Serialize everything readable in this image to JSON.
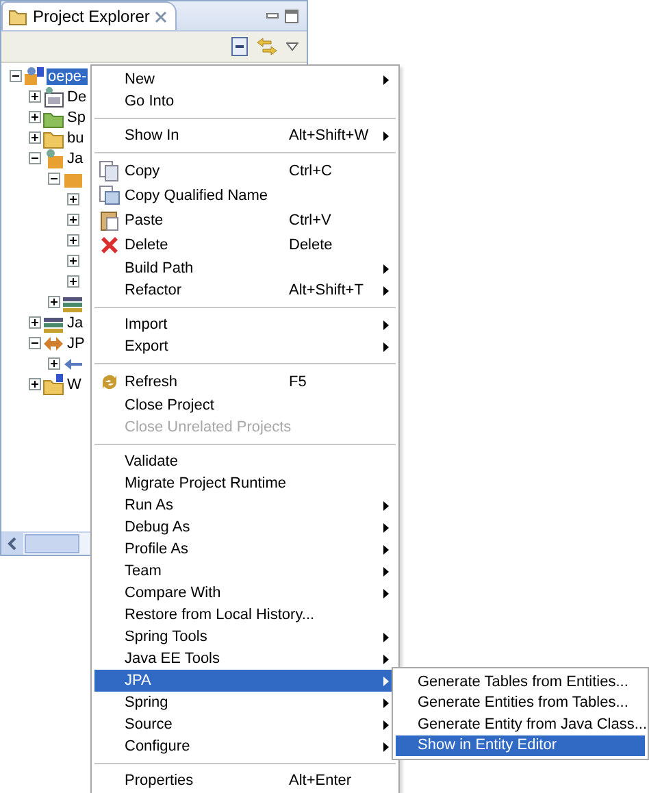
{
  "panel": {
    "title": "Project Explorer"
  },
  "tree": [
    {
      "label": "oepe-",
      "kind": "project",
      "expanded": true,
      "selected": true,
      "children": [
        {
          "label": "De",
          "kind": "descriptor",
          "expanded": false,
          "selected": false
        },
        {
          "label": "Sp",
          "kind": "spring",
          "expanded": false,
          "selected": false
        },
        {
          "label": "bu",
          "kind": "folder",
          "expanded": false,
          "selected": false
        },
        {
          "label": "Ja",
          "kind": "java-resources",
          "expanded": true,
          "selected": false,
          "children": [
            {
              "kind": "source",
              "expanded": true,
              "children": [
                {
                  "expanded": false
                },
                {
                  "expanded": false
                },
                {
                  "expanded": false
                },
                {
                  "expanded": false
                },
                {
                  "expanded": false
                }
              ]
            },
            {
              "kind": "library",
              "expanded": false
            }
          ]
        },
        {
          "label": "Ja",
          "kind": "library",
          "expanded": false,
          "selected": false
        },
        {
          "label": "JP",
          "kind": "jpa",
          "expanded": true,
          "selected": false,
          "children": [
            {
              "kind": "jpa-small",
              "expanded": false
            }
          ]
        },
        {
          "label": "W",
          "kind": "web",
          "expanded": false,
          "selected": false
        }
      ]
    }
  ],
  "context_menu": [
    {
      "kind": "plain",
      "label": "New",
      "submenu": true,
      "disabled": false,
      "selected": false
    },
    {
      "kind": "plain",
      "label": "Go Into",
      "submenu": false,
      "disabled": false,
      "selected": false
    },
    {
      "kind": "separator"
    },
    {
      "kind": "plain",
      "label": "Show In",
      "shortcut": "Alt+Shift+W",
      "submenu": true,
      "disabled": false,
      "selected": false
    },
    {
      "kind": "separator"
    },
    {
      "kind": "copy",
      "label": "Copy",
      "shortcut": "Ctrl+C",
      "submenu": false,
      "disabled": false,
      "selected": false
    },
    {
      "kind": "copy-qualified",
      "label": "Copy Qualified Name",
      "submenu": false,
      "disabled": false,
      "selected": false
    },
    {
      "kind": "paste",
      "label": "Paste",
      "shortcut": "Ctrl+V",
      "submenu": false,
      "disabled": false,
      "selected": false
    },
    {
      "kind": "delete",
      "label": "Delete",
      "shortcut": "Delete",
      "submenu": false,
      "disabled": false,
      "selected": false
    },
    {
      "kind": "plain",
      "label": "Build Path",
      "submenu": true,
      "disabled": false,
      "selected": false
    },
    {
      "kind": "plain",
      "label": "Refactor",
      "shortcut": "Alt+Shift+T",
      "submenu": true,
      "disabled": false,
      "selected": false
    },
    {
      "kind": "separator"
    },
    {
      "kind": "plain",
      "label": "Import",
      "submenu": true,
      "disabled": false,
      "selected": false
    },
    {
      "kind": "plain",
      "label": "Export",
      "submenu": true,
      "disabled": false,
      "selected": false
    },
    {
      "kind": "separator"
    },
    {
      "kind": "refresh",
      "label": "Refresh",
      "shortcut": "F5",
      "submenu": false,
      "disabled": false,
      "selected": false
    },
    {
      "kind": "plain",
      "label": "Close Project",
      "submenu": false,
      "disabled": false,
      "selected": false
    },
    {
      "kind": "plain",
      "label": "Close Unrelated Projects",
      "submenu": false,
      "disabled": true,
      "selected": false
    },
    {
      "kind": "separator"
    },
    {
      "kind": "plain",
      "label": "Validate",
      "submenu": false,
      "disabled": false,
      "selected": false
    },
    {
      "kind": "plain",
      "label": "Migrate Project Runtime",
      "submenu": false,
      "disabled": false,
      "selected": false
    },
    {
      "kind": "plain",
      "label": "Run As",
      "submenu": true,
      "disabled": false,
      "selected": false
    },
    {
      "kind": "plain",
      "label": "Debug As",
      "submenu": true,
      "disabled": false,
      "selected": false
    },
    {
      "kind": "plain",
      "label": "Profile As",
      "submenu": true,
      "disabled": false,
      "selected": false
    },
    {
      "kind": "plain",
      "label": "Team",
      "submenu": true,
      "disabled": false,
      "selected": false
    },
    {
      "kind": "plain",
      "label": "Compare With",
      "submenu": true,
      "disabled": false,
      "selected": false
    },
    {
      "kind": "plain",
      "label": "Restore from Local History...",
      "submenu": false,
      "disabled": false,
      "selected": false
    },
    {
      "kind": "plain",
      "label": "Spring Tools",
      "submenu": true,
      "disabled": false,
      "selected": false
    },
    {
      "kind": "plain",
      "label": "Java EE Tools",
      "submenu": true,
      "disabled": false,
      "selected": false
    },
    {
      "kind": "plain",
      "label": "JPA",
      "submenu": true,
      "disabled": false,
      "selected": true
    },
    {
      "kind": "plain",
      "label": "Spring",
      "submenu": true,
      "disabled": false,
      "selected": false
    },
    {
      "kind": "plain",
      "label": "Source",
      "submenu": true,
      "disabled": false,
      "selected": false
    },
    {
      "kind": "plain",
      "label": "Configure",
      "submenu": true,
      "disabled": false,
      "selected": false
    },
    {
      "kind": "separator"
    },
    {
      "kind": "plain",
      "label": "Properties",
      "shortcut": "Alt+Enter",
      "submenu": false,
      "disabled": false,
      "selected": false
    }
  ],
  "submenu": [
    {
      "label": "Generate Tables from Entities...",
      "selected": false
    },
    {
      "label": "Generate Entities from Tables...",
      "selected": false
    },
    {
      "label": "Generate Entity from Java Class...",
      "selected": false
    },
    {
      "label": "Show in Entity Editor",
      "selected": true
    }
  ]
}
